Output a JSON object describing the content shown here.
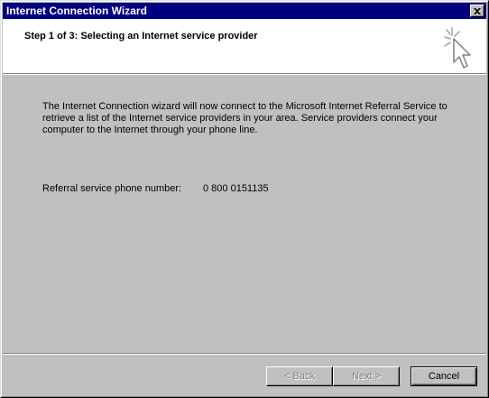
{
  "window": {
    "title": "Internet Connection Wizard",
    "close_icon": "close-icon"
  },
  "header": {
    "title": "Step 1 of 3: Selecting an Internet service provider",
    "icon": "wizard-sparkle-cursor-icon"
  },
  "content": {
    "description": "The Internet Connection wizard will now connect to the Microsoft Internet Referral Service to retrieve a list of the Internet service providers in your area. Service providers connect your computer to the Internet through your phone line.",
    "phone_label": "Referral service phone number:",
    "phone_value": "0 800 0151135"
  },
  "buttons": {
    "back": "< Back",
    "next": "Next >",
    "cancel": "Cancel"
  },
  "colors": {
    "titlebar": "#000080",
    "face": "#c0c0c0",
    "header_bg": "#ffffff",
    "disabled_text": "#808080"
  }
}
